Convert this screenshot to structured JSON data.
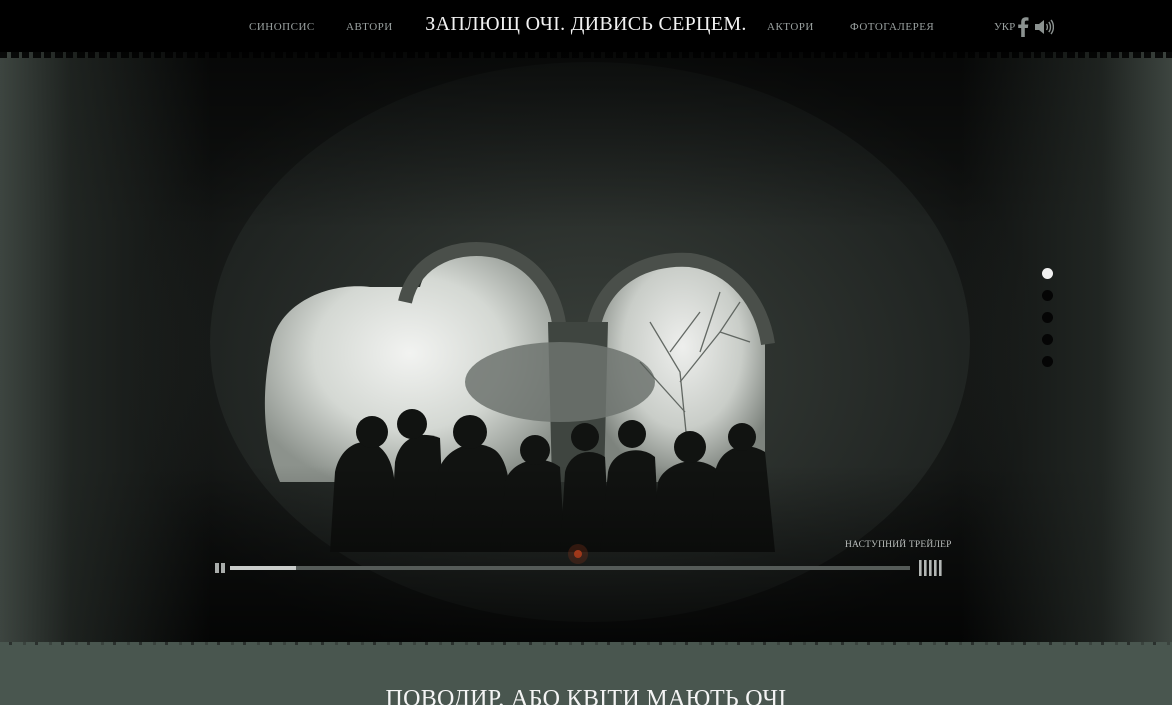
{
  "header": {
    "nav_left": [
      "СИНОПСИС",
      "АВТОРИ"
    ],
    "title": "ЗАПЛЮЩ ОЧІ. ДИВИСЬ СЕРЦЕМ.",
    "nav_right": [
      "АКТОРИ",
      "ФОТОГАЛЕРЕЯ"
    ],
    "language": "УКР",
    "icons": [
      "facebook-icon",
      "sound-icon"
    ]
  },
  "player": {
    "slides_count": 5,
    "active_slide": 1,
    "next_trailer_label": "НАСТУПНИЙ ТРЕЙЛЕР",
    "progress_fraction": 0.097,
    "icons": [
      "pause-icon",
      "volume-bars-icon"
    ]
  },
  "section": {
    "title": "ПОВОДИР, АБО КВІТИ МАЮТЬ ОЧІ"
  },
  "colors": {
    "header_bg": "#000000",
    "lower_bg": "#49564f",
    "active_dot": "#f0f0f0"
  }
}
